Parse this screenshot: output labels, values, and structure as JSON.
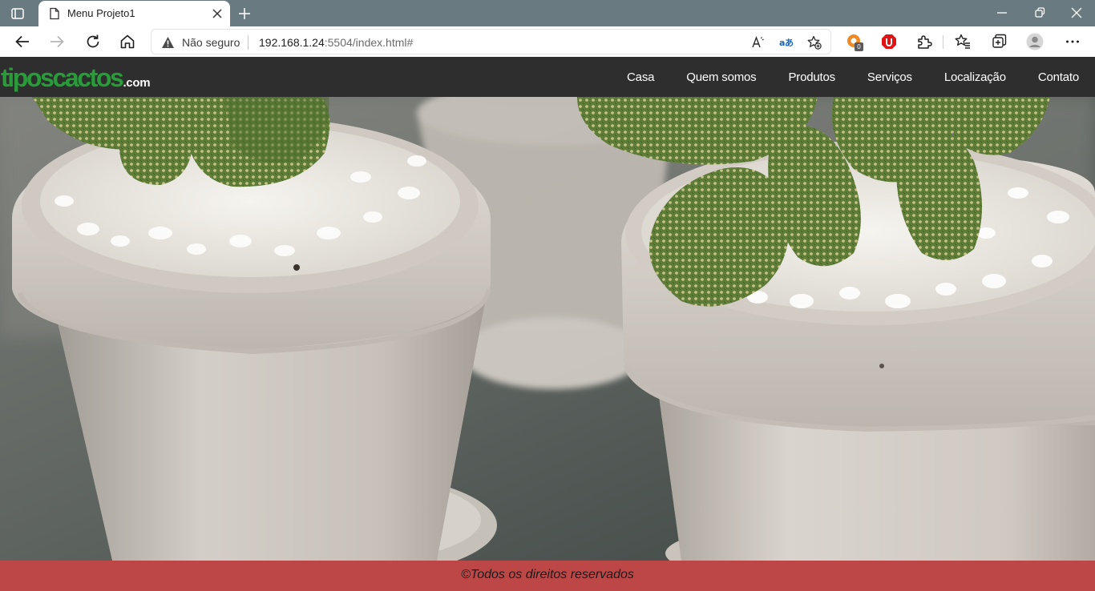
{
  "browser": {
    "tab_title": "Menu Projeto1",
    "security_label": "Não seguro",
    "url_host": "192.168.1.24",
    "url_rest": ":5504/index.html#",
    "extension_badge": "0"
  },
  "site": {
    "logo_main": "tiposcactos",
    "logo_tld": ".com",
    "nav": {
      "home": "Casa",
      "about": "Quem somos",
      "products": "Produtos",
      "services": "Serviços",
      "location": "Localização",
      "contact": "Contato"
    },
    "footer_text": "©Todos os direitos reservados"
  },
  "colors": {
    "tabbar": "#697b80",
    "header": "#2f2e2f",
    "logo_green": "#2a9a3a",
    "footer": "#bd4647"
  },
  "icons": {
    "tab_actions": "tab-actions-icon",
    "favicon": "page-icon",
    "close": "close-icon",
    "new_tab": "plus-icon",
    "back": "back-arrow-icon",
    "forward": "forward-arrow-icon",
    "refresh": "refresh-icon",
    "home": "home-icon",
    "warning": "warning-icon",
    "read_aloud": "read-aloud-icon",
    "translate": "translate-icon",
    "favorite_add": "star-add-icon",
    "extensions": "puzzle-icon",
    "favorites": "favorites-icon",
    "collections": "collections-icon",
    "profile": "avatar-icon",
    "more": "more-icon"
  }
}
